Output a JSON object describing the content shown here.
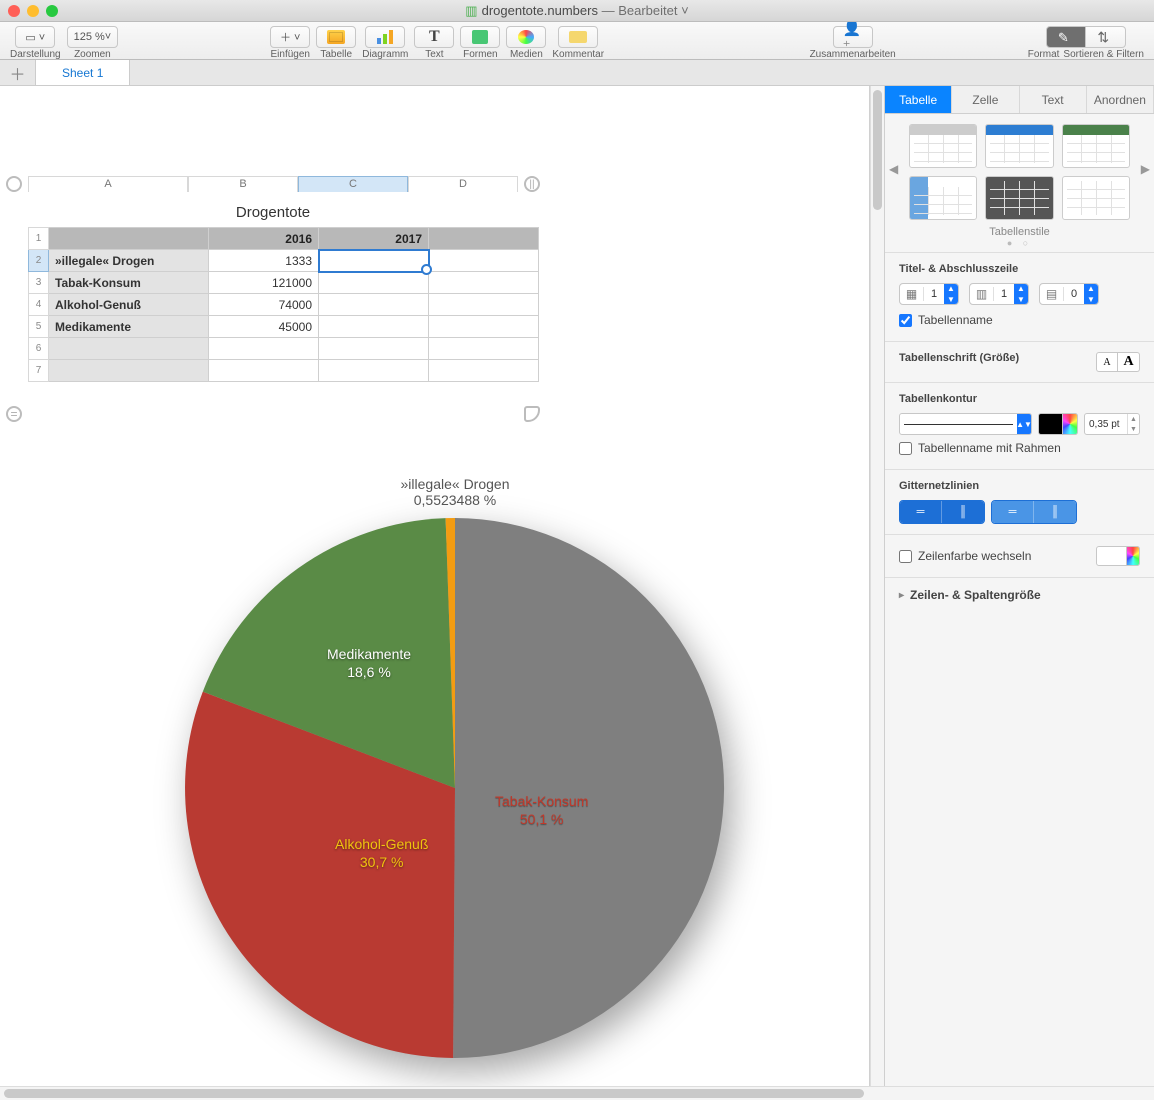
{
  "window": {
    "filename": "drogentote.numbers",
    "status": "Bearbeitet"
  },
  "toolbar": {
    "darstellung": "Darstellung",
    "zoom_value": "125 %",
    "zoom_label": "Zoomen",
    "einfuegen": "Einfügen",
    "tabelle": "Tabelle",
    "diagramm": "Diagramm",
    "text": "Text",
    "formen": "Formen",
    "medien": "Medien",
    "kommentar": "Kommentar",
    "zusammen": "Zusammenarbeiten",
    "format": "Format",
    "sortieren": "Sortieren & Filtern"
  },
  "sheet_tab": "Sheet 1",
  "table": {
    "title": "Drogentote",
    "cols": [
      "A",
      "B",
      "C",
      "D"
    ],
    "header": {
      "b": "2016",
      "c": "2017"
    },
    "rows": [
      {
        "label": "»illegale« Drogen",
        "b": "1333"
      },
      {
        "label": "Tabak-Konsum",
        "b": "121000"
      },
      {
        "label": "Alkohol-Genuß",
        "b": "74000"
      },
      {
        "label": "Medikamente",
        "b": "45000"
      }
    ]
  },
  "chart_data": {
    "type": "pie",
    "series": [
      {
        "name": "»illegale« Drogen",
        "value": 1333,
        "pct": "0,5523488 %",
        "color": "#f39c12"
      },
      {
        "name": "Tabak-Konsum",
        "value": 121000,
        "pct": "50,1 %",
        "color": "#7f7f7f"
      },
      {
        "name": "Alkohol-Genuß",
        "value": 74000,
        "pct": "30,7 %",
        "color": "#b93a32"
      },
      {
        "name": "Medikamente",
        "value": 45000,
        "pct": "18,6 %",
        "color": "#5a8b46"
      }
    ]
  },
  "pie_labels": {
    "top_name": "»illegale« Drogen",
    "top_pct": "0,5523488 %",
    "tabak_name": "Tabak-Konsum",
    "tabak_pct": "50,1 %",
    "alkohol_name": "Alkohol-Genuß",
    "alkohol_pct": "30,7 %",
    "medi_name": "Medikamente",
    "medi_pct": "18,6 %"
  },
  "inspector": {
    "tabs": {
      "tabelle": "Tabelle",
      "zelle": "Zelle",
      "text": "Text",
      "anordnen": "Anordnen"
    },
    "styles_caption": "Tabellenstile",
    "sec_titelzeile": "Titel- & Abschlusszeile",
    "header_rows": "1",
    "header_cols": "1",
    "footer_rows": "0",
    "chk_tabellenname": "Tabellenname",
    "sec_schrift": "Tabellenschrift (Größe)",
    "sec_kontur": "Tabellenkontur",
    "outline_pt": "0,35 pt",
    "chk_name_rahmen": "Tabellenname mit Rahmen",
    "sec_gitter": "Gitternetzlinien",
    "chk_zeilenfarbe": "Zeilenfarbe wechseln",
    "sec_groesse": "Zeilen- & Spaltengröße"
  }
}
